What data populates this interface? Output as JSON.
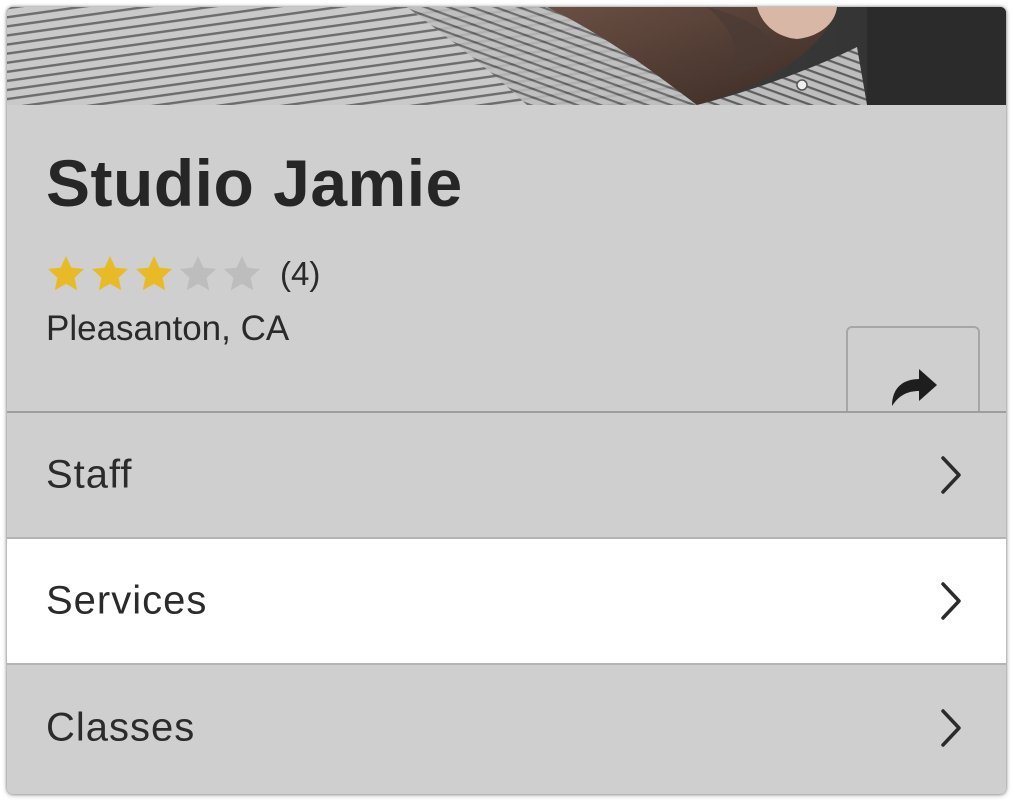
{
  "business": {
    "name": "Studio Jamie",
    "rating": 3,
    "rating_max": 5,
    "review_count": "(4)",
    "location": "Pleasanton, CA"
  },
  "icons": {
    "share": "share-arrow-icon",
    "star": "star-icon",
    "chevron": "chevron-right-icon"
  },
  "colors": {
    "star_filled": "#e8bb26",
    "star_empty": "#bdbdbd",
    "header_bg": "#cfcfcf",
    "active_row_bg": "#ffffff"
  },
  "menu": {
    "items": [
      {
        "label": "Staff",
        "active": false
      },
      {
        "label": "Services",
        "active": true
      },
      {
        "label": "Classes",
        "active": false
      }
    ]
  }
}
